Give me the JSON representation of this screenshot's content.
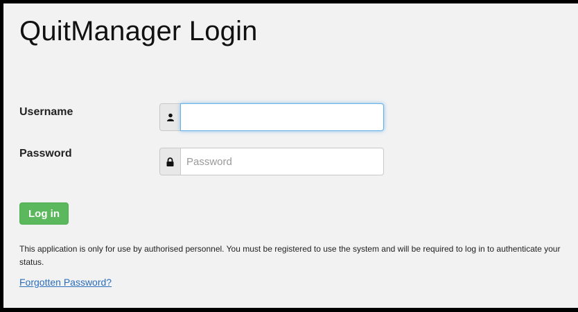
{
  "page": {
    "title": "QuitManager Login"
  },
  "form": {
    "username_label": "Username",
    "username_value": "",
    "username_placeholder": "",
    "password_label": "Password",
    "password_value": "",
    "password_placeholder": "Password",
    "login_button": "Log in"
  },
  "footer": {
    "notice": "This application is only for use by authorised personnel. You must be registered to use the system and will be required to log in to authenticate your status.",
    "forgot_link": "Forgotten Password?"
  },
  "icons": {
    "username_icon": "user-icon",
    "password_icon": "lock-icon"
  },
  "colors": {
    "login_button": "#5cb85c",
    "link": "#2a6ebb",
    "focus_border": "#66afe9",
    "background": "#f2f2f2"
  }
}
